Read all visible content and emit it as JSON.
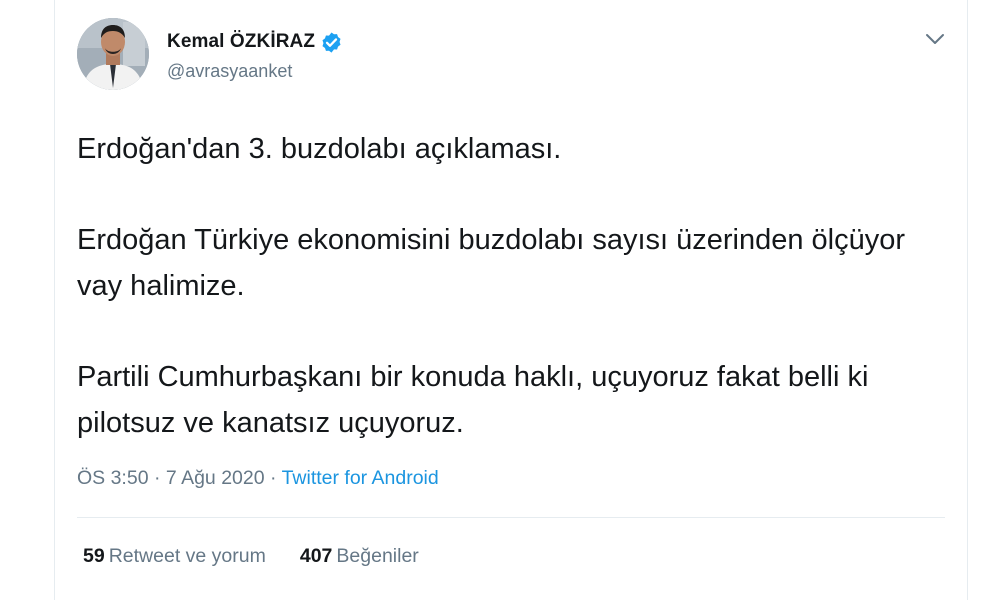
{
  "tweet": {
    "author": {
      "name": "Kemal ÖZKİRAZ",
      "handle": "@avrasyaanket",
      "verified": true
    },
    "paragraphs": [
      "Erdoğan'dan 3. buzdolabı açıklaması.",
      "Erdoğan Türkiye ekonomisini buzdolabı sayısı üzerinden ölçüyor vay halimize.",
      "Partili Cumhurbaşkanı bir konuda haklı, uçuyoruz fakat belli ki pilotsuz ve kanatsız uçuyoruz."
    ],
    "meta": {
      "time": "ÖS 3:50",
      "separator": "·",
      "date": "7 Ağu 2020",
      "source": "Twitter for Android"
    },
    "stats": {
      "retweets_count": "59",
      "retweets_label": "Retweet ve yorum",
      "likes_count": "407",
      "likes_label": "Beğeniler"
    }
  },
  "icons": {
    "verified": "verified-badge-icon",
    "menu": "chevron-down-icon"
  },
  "colors": {
    "text": "#14171a",
    "secondary": "#657786",
    "link": "#1b95e0",
    "verified": "#1da1f2",
    "divider": "#e6ecf0"
  }
}
